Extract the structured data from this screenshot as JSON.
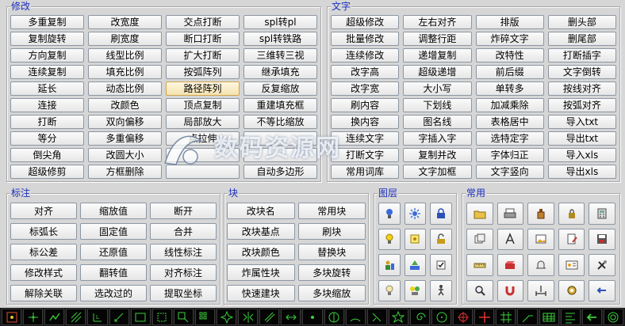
{
  "groups": {
    "modify": {
      "title": "修改",
      "buttons": [
        "多重复制",
        "改宽度",
        "交点打断",
        "spl转pl",
        "复制旋转",
        "刷宽度",
        "断口打断",
        "spl转铁路",
        "方向复制",
        "线型比例",
        "扩大打断",
        "三维转三视",
        "连续复制",
        "填充比例",
        "按弧阵列",
        "继承填充",
        "延长",
        "动态比例",
        "路径阵列",
        "反复缩放",
        "连接",
        "改颜色",
        "顶点复制",
        "重建填充框",
        "打断",
        "双向偏移",
        "局部放大",
        "不等比缩放",
        "等分",
        "多重偏移",
        "点拉伸",
        "",
        "倒尖角",
        "改圆大小",
        "",
        "",
        "超级修剪",
        "方框删除",
        "",
        "自动多边形"
      ],
      "selected": "路径阵列"
    },
    "text": {
      "title": "文字",
      "buttons": [
        "超级修改",
        "左右对齐",
        "排版",
        "删头部",
        "批量修改",
        "调整行距",
        "炸碎文字",
        "删尾部",
        "连续修改",
        "递增复制",
        "改特性",
        "打断插字",
        "改字高",
        "超级递增",
        "前后缀",
        "文字倒转",
        "改字宽",
        "大小写",
        "单转多",
        "按线对齐",
        "刷内容",
        "下划线",
        "加减乘除",
        "按弧对齐",
        "换内容",
        "图名线",
        "表格居中",
        "导入txt",
        "连续文字",
        "字插入字",
        "选特定字",
        "导出txt",
        "打断文字",
        "复制并改",
        "字体归正",
        "导入xls",
        "常用词库",
        "文字加框",
        "文字竖向",
        "导出xls"
      ]
    },
    "dimension": {
      "title": "标注",
      "buttons": [
        "对齐",
        "缩放值",
        "断开",
        "标弧长",
        "固定值",
        "合并",
        "标公差",
        "还原值",
        "线性标注",
        "修改样式",
        "翻转值",
        "对齐标注",
        "解除关联",
        "选改过的",
        "提取坐标"
      ]
    },
    "block": {
      "title": "块",
      "buttons": [
        "改块名",
        "常用块",
        "改块基点",
        "刷块",
        "改块颜色",
        "替换块",
        "炸属性块",
        "多块旋转",
        "快速建块",
        "多块缩放"
      ]
    },
    "layer": {
      "title": "图层",
      "icons": [
        "bulb-blue-icon",
        "sun-icon",
        "lock-icon",
        "bulb-yellow-icon",
        "layer-freeze-icon",
        "unlock-icon",
        "layer-people-icon",
        "layer-match-icon",
        "layer-check-icon",
        "bulb-off-icon",
        "bulb-group-icon",
        "layer-walk-icon"
      ]
    },
    "common": {
      "title": "常用",
      "icons": [
        "open-folder-icon",
        "print-icon",
        "paint-bottle-icon",
        "lock-small-icon",
        "calculator-icon",
        "copy-stamp-icon",
        "text-style-icon",
        "image-icon",
        "document-edit-icon",
        "save-disk-icon",
        "ruler-icon",
        "red-block-icon",
        "hat-icon",
        "id-card-icon",
        "tools-icon",
        "zoom-icon",
        "magnet-icon",
        "measure-icon",
        "gear-icon",
        "exit-icon"
      ]
    }
  },
  "toolbar": {
    "icons": [
      "snap-grid-icon",
      "pick-point-icon",
      "polyline-icon",
      "hatch-icon",
      "dimension-icon",
      "rotate-dim-icon",
      "rectangle-icon",
      "region-icon",
      "zoom-window-icon",
      "array-icon",
      "explode-icon",
      "mirror-icon",
      "offset-icon",
      "stretch-icon",
      "point-icon",
      "compass-icon",
      "arc-icon",
      "trim-icon",
      "star-icon",
      "spiral-icon",
      "circle-icon",
      "crosshair-icon",
      "cross-icon",
      "grid-lines-icon",
      "leader-icon",
      "table-icon",
      "align-icon",
      "back-arrow-icon",
      "target-icon"
    ]
  },
  "watermark": {
    "text": "数码资源网"
  },
  "colors": {
    "accent": "#1b2fbf",
    "toolbar": "#050505",
    "selected": "#f5e2b0"
  }
}
